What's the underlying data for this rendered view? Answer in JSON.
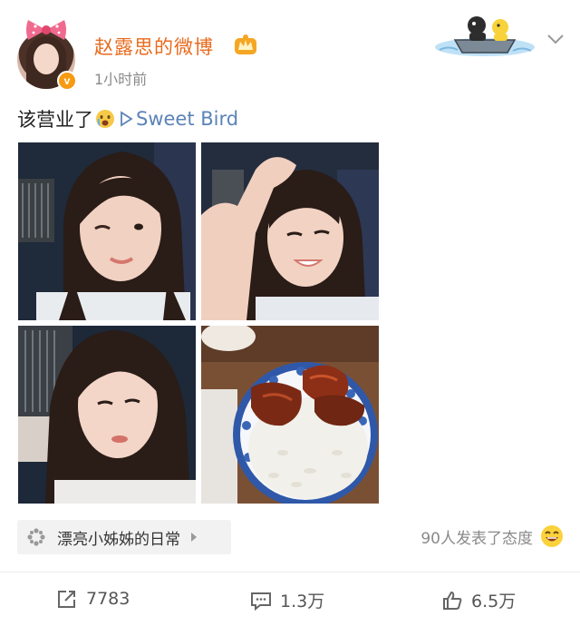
{
  "post": {
    "author": "赵露思的微博",
    "time": "1小时前",
    "text": "该营业了",
    "music_link": "Sweet Bird"
  },
  "topic": {
    "label": "漂亮小姊姊的日常"
  },
  "reactions": {
    "summary": "90人发表了态度"
  },
  "actions": {
    "repost_count": "7783",
    "comment_count": "1.3万",
    "like_count": "6.5万"
  },
  "colors": {
    "username": "#e96a1d",
    "link": "#5b83b8",
    "muted": "#8a8a8a",
    "verified": "#f79a12"
  },
  "icons": {
    "verified": "verified-v-icon",
    "vip": "vip-crown-icon",
    "more": "chevron-down-icon",
    "play": "play-icon",
    "topic": "topic-pinwheel-icon",
    "smile": "smile-icon",
    "repost": "repost-icon",
    "comment": "comment-icon",
    "like": "like-icon"
  },
  "photos": [
    {
      "alt": "selfie-wink"
    },
    {
      "alt": "selfie-hand-on-head"
    },
    {
      "alt": "selfie-close-up"
    },
    {
      "alt": "rice-with-braised-meat"
    }
  ]
}
